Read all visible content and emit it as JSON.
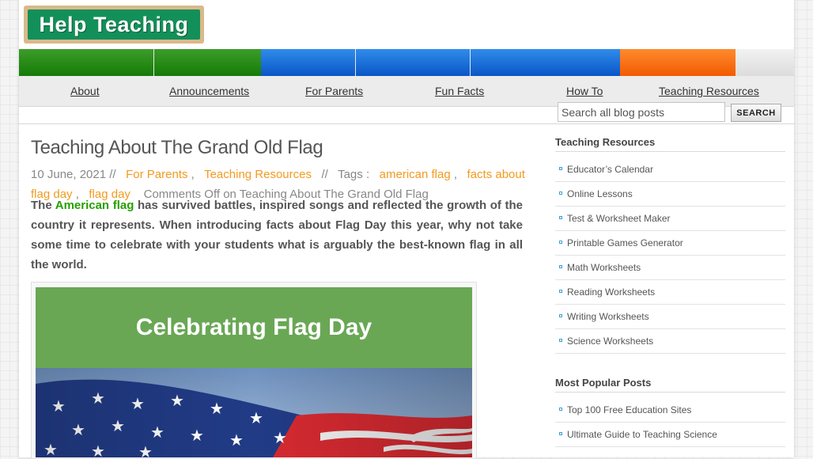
{
  "logo": {
    "text": "Help Teaching"
  },
  "nav": {
    "items": [
      {
        "label": "About"
      },
      {
        "label": "Announcements"
      },
      {
        "label": "For Parents"
      },
      {
        "label": "Fun Facts"
      },
      {
        "label": "How To"
      },
      {
        "label": "Teaching Resources"
      }
    ]
  },
  "search": {
    "placeholder": "Search all blog posts",
    "button": "SEARCH"
  },
  "post": {
    "title": "Teaching About The Grand Old Flag",
    "date": "10 June, 2021",
    "meta_sep": "//",
    "categories": [
      "For Parents",
      "Teaching Resources"
    ],
    "tags_label": "Tags :",
    "tags": [
      "american flag",
      "facts about flag day",
      "flag day"
    ],
    "comments": "Comments Off on Teaching About The Grand Old Flag",
    "body_start": "The",
    "body_link": "American flag",
    "body_rest": "has survived battles, inspired songs and reflected the growth of the country it represents. When introducing facts about Flag Day this year, why not take some time to celebrate with your students what is arguably the best-known flag in all the world.",
    "image_caption": "Celebrating Flag Day"
  },
  "sidebar": {
    "resources_title": "Teaching Resources",
    "resources": [
      "Educator’s Calendar",
      "Online Lessons",
      "Test & Worksheet Maker",
      "Printable Games Generator",
      "Math Worksheets",
      "Reading Worksheets",
      "Writing Worksheets",
      "Science Worksheets"
    ],
    "popular_title": "Most Popular Posts",
    "popular": [
      "Top 100 Free Education Sites",
      "Ultimate Guide to Teaching Science"
    ]
  },
  "colors": {
    "logo_green": "#139059",
    "link_orange": "#f39a20",
    "link_green": "#26a000",
    "bar_green": "#1f8512",
    "bar_blue": "#1565d8",
    "bar_orange": "#f76b0e",
    "banner_green": "#69a755"
  }
}
